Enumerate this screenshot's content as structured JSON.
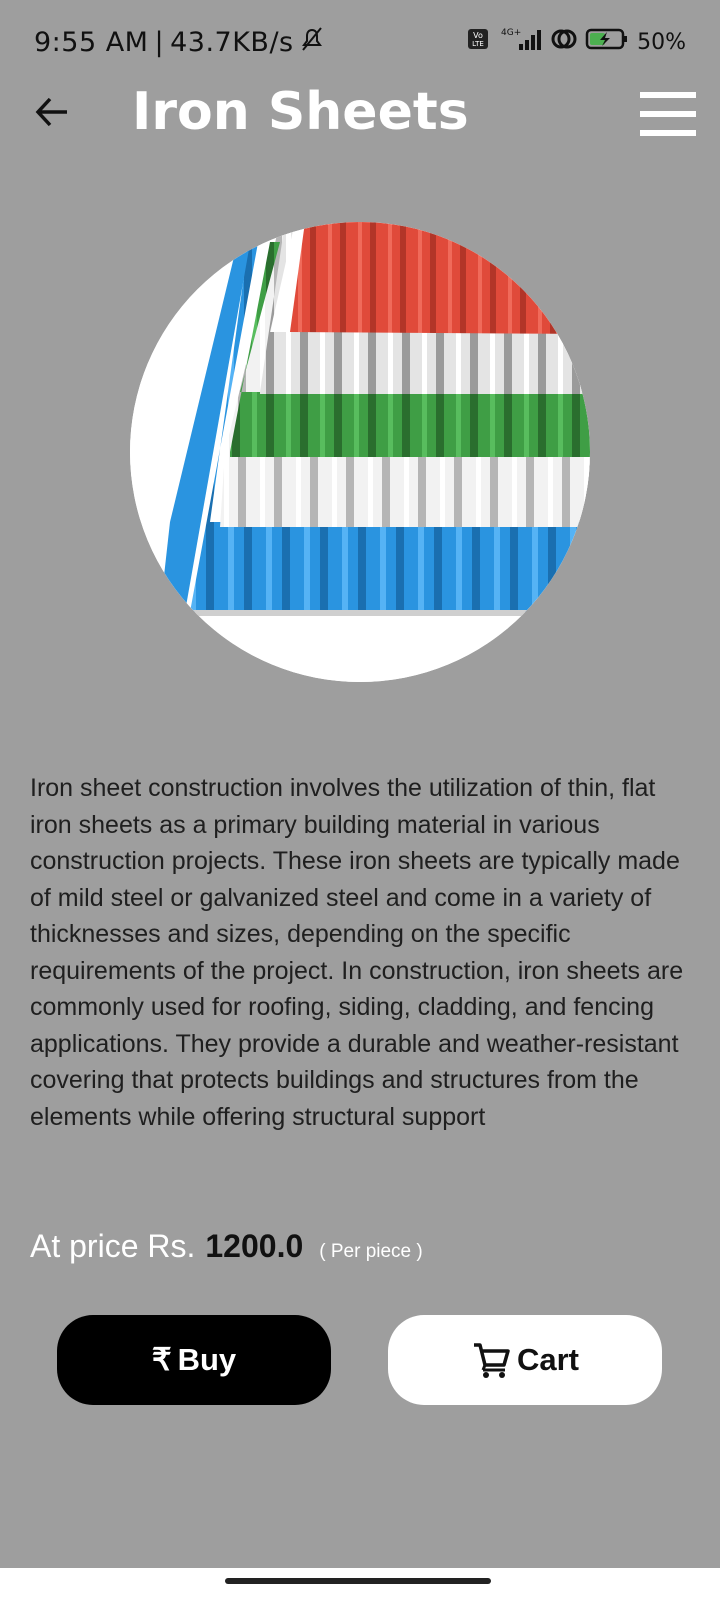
{
  "status_bar": {
    "time": "9:55 AM",
    "network_speed": "43.7KB/s",
    "network_type": "4G+",
    "volte": "Vo LTE",
    "battery": "50%"
  },
  "app_bar": {
    "title": "Iron Sheets"
  },
  "product": {
    "description": "Iron sheet construction involves the utilization of thin, flat iron sheets as a primary building material in various construction projects. These iron sheets are typically made of mild steel or galvanized steel and come in a variety of thicknesses and sizes, depending on the specific requirements of the project.  In construction, iron sheets are commonly used for roofing, siding, cladding, and fencing applications. They provide a durable and weather-resistant covering that protects buildings and structures from the elements while offering structural support",
    "price_prefix": "At price Rs.",
    "price": "1200.0",
    "price_unit": "( Per piece )"
  },
  "actions": {
    "buy_symbol": "₹",
    "buy_label": "Buy",
    "cart_label": "Cart"
  },
  "colors": {
    "background": "#9e9e9e",
    "buy_button": "#000000",
    "cart_button": "#ffffff",
    "sheet_red": "#e04a3a",
    "sheet_green": "#3f9e45",
    "sheet_blue": "#2a94e0",
    "sheet_silver": "#d8d8d8"
  }
}
